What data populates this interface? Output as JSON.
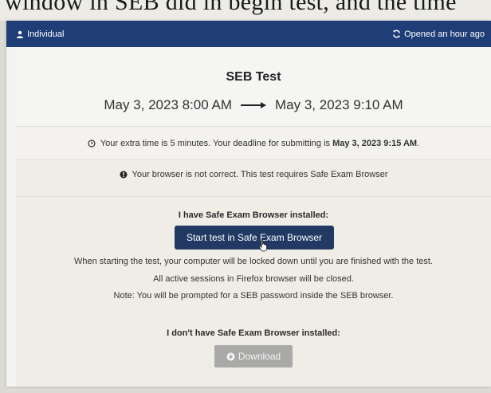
{
  "background_text": "window in SEB did in begin test, and the time",
  "header": {
    "left_label": "Individual",
    "left_icon": "user-icon",
    "right_label": "Opened an hour ago",
    "right_icon": "refresh-icon",
    "color": "#1f3e78"
  },
  "test": {
    "title": "SEB Test",
    "start": "May 3, 2023 8:00 AM",
    "end": "May 3, 2023 9:10 AM",
    "arrow_icon": "long-arrow-right-icon"
  },
  "extra_time": {
    "icon": "clock-icon",
    "text": "Your extra time is 5 minutes. Your deadline for submitting is ",
    "deadline": "May 3, 2023 9:15 AM",
    "suffix": "."
  },
  "browser_warning": {
    "icon": "exclamation-circle-icon",
    "text": "Your browser is not correct. This test requires Safe Exam Browser"
  },
  "seb_installed": {
    "label": "I have Safe Exam Browser installed:",
    "button_label": "Start test in Safe Exam Browser",
    "button_color": "#223a63",
    "info_lines": [
      "When starting the test, your computer will be locked down until you are finished with the test.",
      "All active sessions in Firefox browser will be closed.",
      "Note: You will be prompted for a SEB password inside the SEB browser."
    ]
  },
  "seb_not_installed": {
    "label": "I don't have Safe Exam Browser installed:",
    "button_label": "Download",
    "button_icon": "download-circle-icon"
  }
}
